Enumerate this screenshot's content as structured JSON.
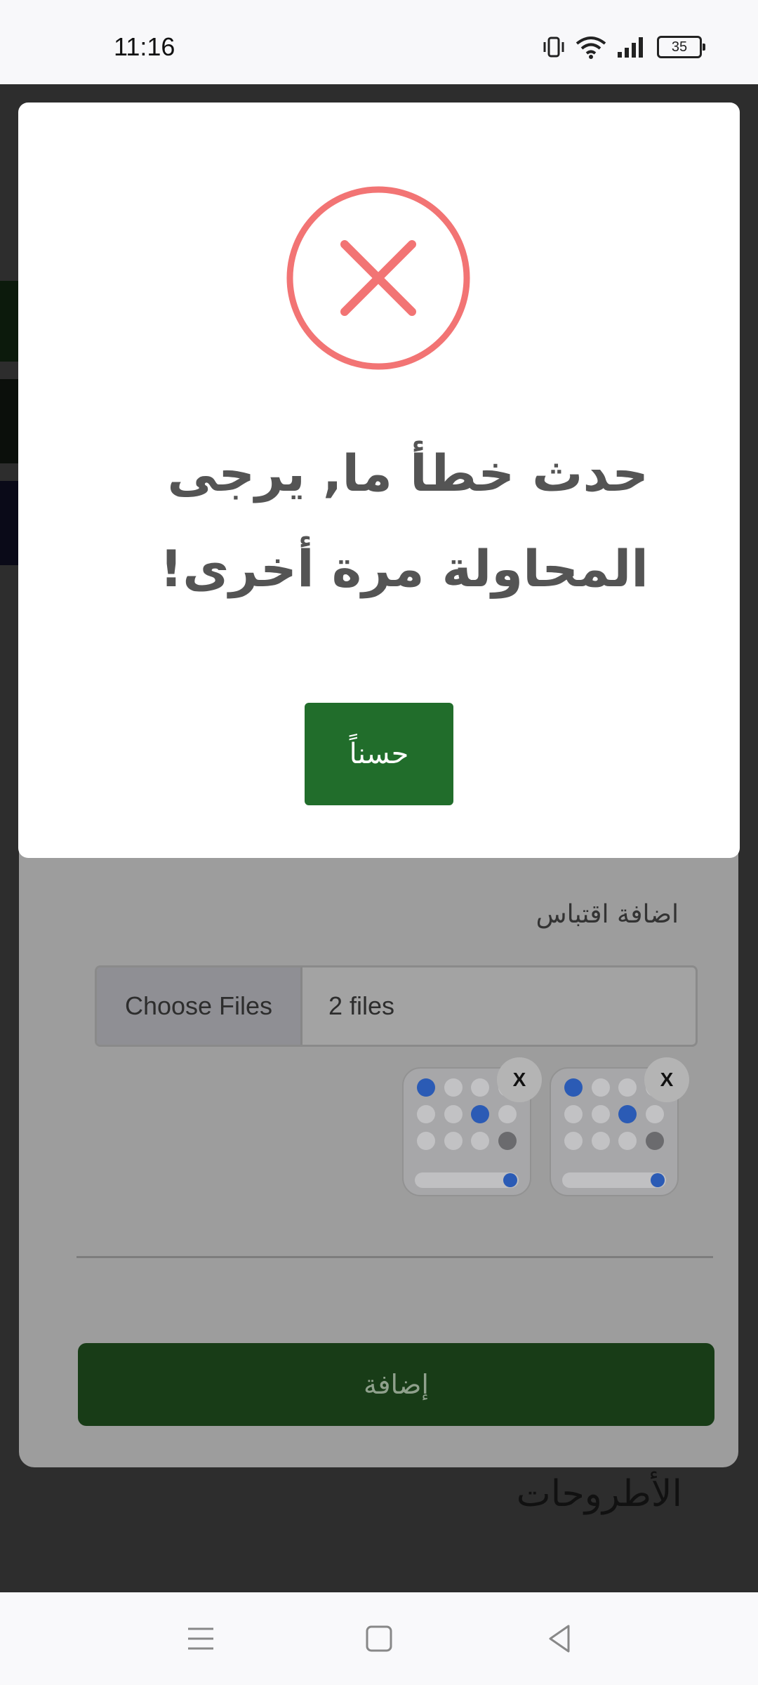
{
  "status_bar": {
    "time": "11:16",
    "battery": "35",
    "icons": [
      "vibrate-icon",
      "wifi-icon",
      "signal-icon",
      "battery-icon"
    ]
  },
  "modal": {
    "icon": "error-x-icon",
    "icon_color": "#f27474",
    "message_line1": "حدث خطأ ما, يرجى",
    "message_line2": "المحاولة مرة أخرى!",
    "ok_label": "حسناً",
    "ok_color": "#216d2b"
  },
  "background_form": {
    "quote_label": "اضافة اقتباس",
    "choose_files_label": "Choose Files",
    "files_selected": "2 files",
    "remove_label": "X",
    "add_button_label": "إضافة",
    "section_title": "الأطروحات"
  },
  "nav_bar": {
    "icons": [
      "menu-icon",
      "home-icon",
      "back-icon"
    ]
  }
}
